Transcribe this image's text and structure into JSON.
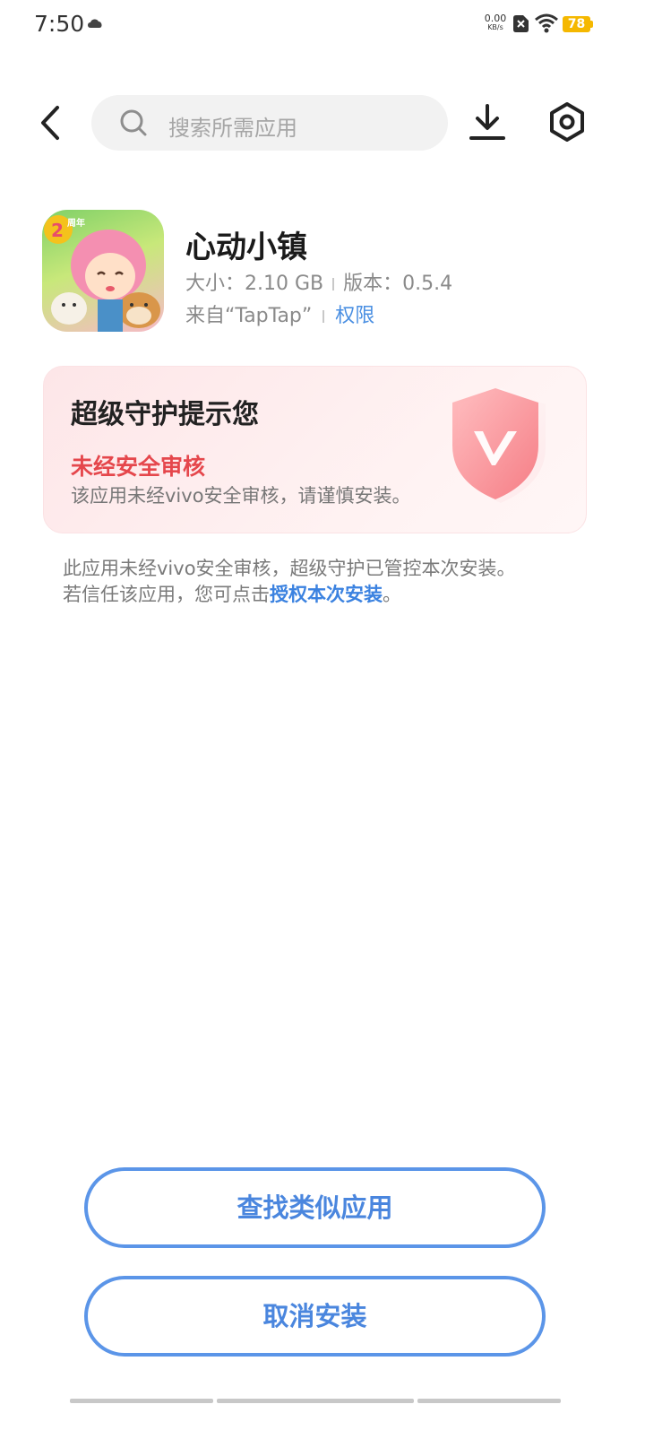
{
  "status_bar": {
    "time": "7:50",
    "net_speed_value": "0.00",
    "net_speed_unit": "KB/s",
    "battery_level": "78"
  },
  "search": {
    "placeholder": "搜索所需应用"
  },
  "app": {
    "name": "心动小镇",
    "size_label": "大小：2.10 GB",
    "version_label": "版本：0.5.4",
    "source_label": "来自“TapTap”",
    "permission_label": "权限",
    "icon_badge": "2周年"
  },
  "protection": {
    "title": "超级守护提示您",
    "warning": "未经安全审核",
    "description": "该应用未经vivo安全审核，请谨慎安装。"
  },
  "notice": {
    "line1": "此应用未经vivo安全审核，超级守护已管控本次安装。",
    "line2_prefix": "若信任该应用，您可点击",
    "line2_link": "授权本次安装",
    "line2_suffix": "。"
  },
  "buttons": {
    "find_similar": "查找类似应用",
    "cancel_install": "取消安装"
  },
  "colors": {
    "accent": "#4a86de",
    "warning": "#e5474c",
    "battery": "#f5b800"
  }
}
